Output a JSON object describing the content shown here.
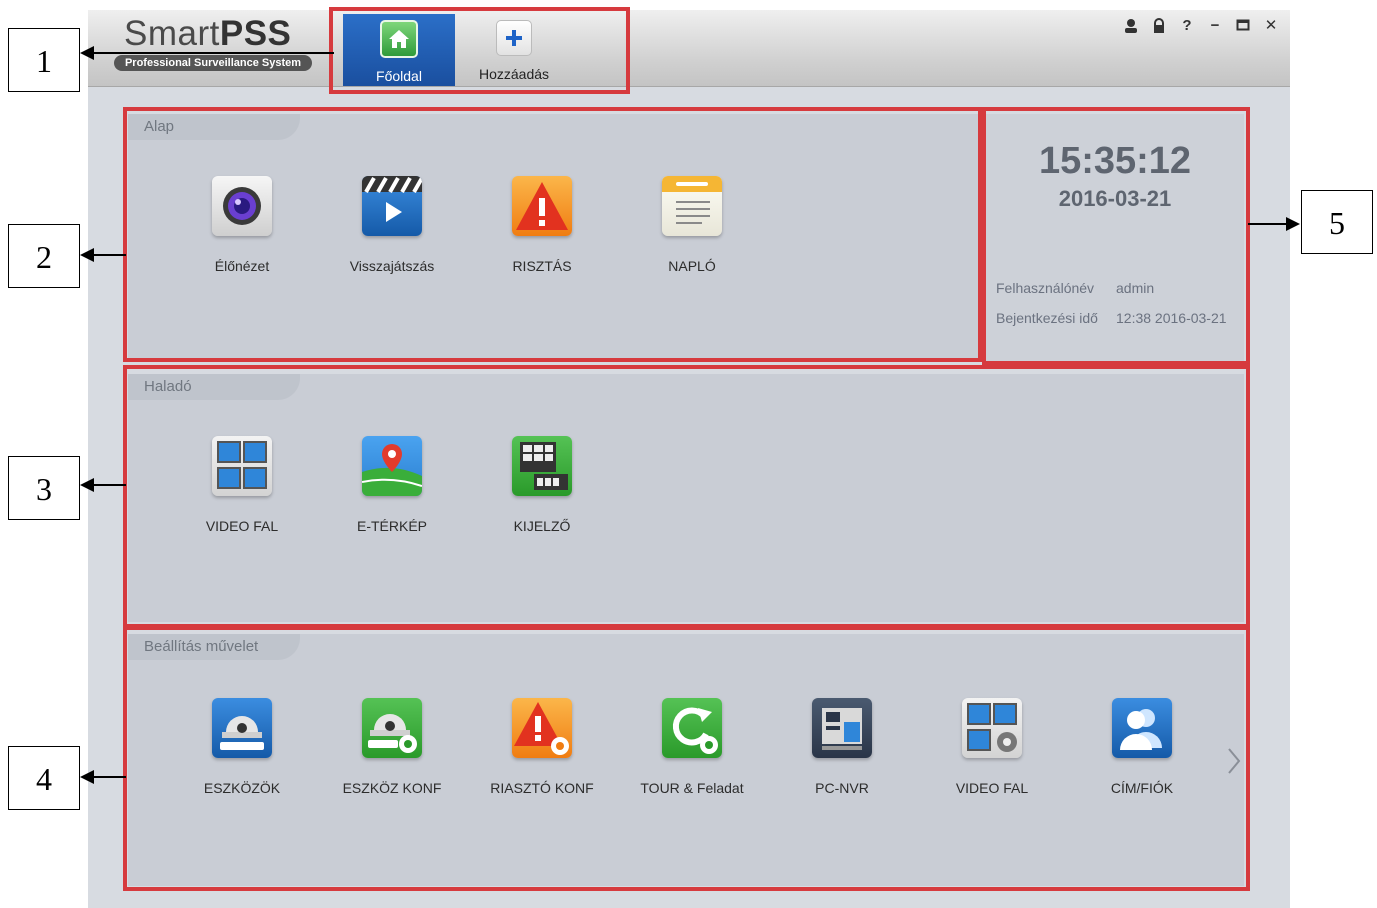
{
  "header": {
    "logo_main": "Smart",
    "logo_bold": "PSS",
    "logo_tagline": "Professional Surveillance System",
    "tabs": [
      {
        "label": "Főoldal",
        "icon": "home-icon",
        "active": true
      },
      {
        "label": "Hozzáadás",
        "icon": "plus-icon",
        "active": false
      }
    ],
    "window_controls": [
      {
        "icon": "user-icon",
        "glyph": "♟"
      },
      {
        "icon": "lock-icon",
        "glyph": "🔒"
      },
      {
        "icon": "help-icon",
        "glyph": "?"
      },
      {
        "icon": "minimize-icon",
        "glyph": "−"
      },
      {
        "icon": "maximize-icon",
        "glyph": "▭"
      },
      {
        "icon": "close-icon",
        "glyph": "✕"
      }
    ]
  },
  "sections": {
    "basic": {
      "title": "Alap",
      "items": [
        {
          "label": "Élőnézet",
          "icon": "camera-icon"
        },
        {
          "label": "Visszajátszás",
          "icon": "clapperboard-icon"
        },
        {
          "label": "RISZTÁS",
          "icon": "alarm-icon"
        },
        {
          "label": "NAPLÓ",
          "icon": "notepad-icon"
        }
      ]
    },
    "advanced": {
      "title": "Haladó",
      "items": [
        {
          "label": "VIDEO FAL",
          "icon": "video-wall-icon"
        },
        {
          "label": "E-TÉRKÉP",
          "icon": "map-pin-icon"
        },
        {
          "label": "KIJELZŐ",
          "icon": "display-icon"
        }
      ]
    },
    "settings": {
      "title": "Beállítás művelet",
      "items": [
        {
          "label": "ESZKÖZÖK",
          "icon": "dome-camera-icon"
        },
        {
          "label": "ESZKÖZ KONF",
          "icon": "dome-camera-gear-icon"
        },
        {
          "label": "RIASZTÓ KONF",
          "icon": "alarm-gear-icon"
        },
        {
          "label": "TOUR & Feladat",
          "icon": "refresh-gear-icon"
        },
        {
          "label": "PC-NVR",
          "icon": "pc-nvr-icon"
        },
        {
          "label": "VIDEO FAL",
          "icon": "video-wall-gear-icon"
        },
        {
          "label": "CÍM/FIÓK",
          "icon": "users-icon"
        }
      ],
      "next_icon": "chevron-right-icon"
    }
  },
  "info": {
    "time": "15:35:12",
    "date": "2016-03-21",
    "username_label": "Felhasználónév",
    "username_value": "admin",
    "login_label": "Bejentkezési idő",
    "login_value": "12:38 2016-03-21"
  },
  "callouts": [
    "1",
    "2",
    "3",
    "4",
    "5"
  ],
  "colors": {
    "highlight": "#d63a3e",
    "accent": "#1a4f9f"
  }
}
